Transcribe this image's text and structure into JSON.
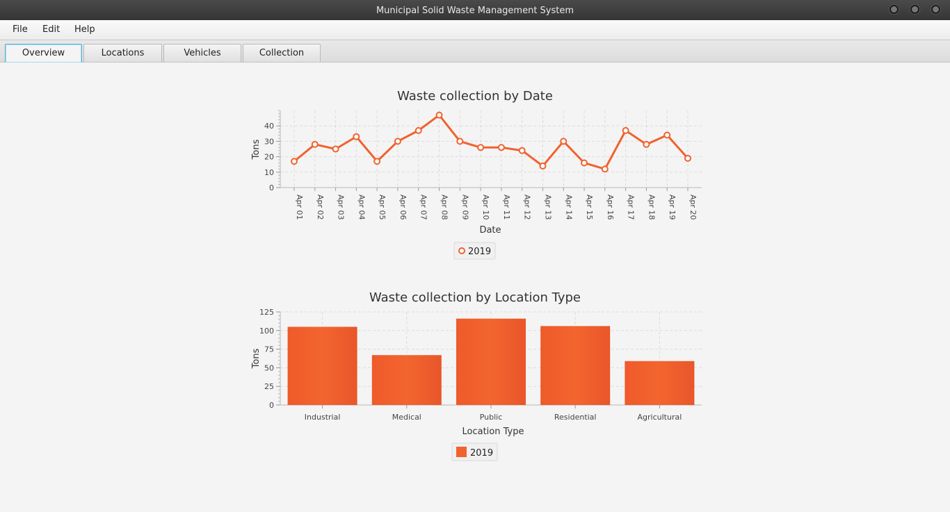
{
  "window": {
    "title": "Municipal Solid Waste Management System"
  },
  "menu": {
    "items": [
      "File",
      "Edit",
      "Help"
    ]
  },
  "tabs": [
    {
      "label": "Overview",
      "active": true
    },
    {
      "label": "Locations",
      "active": false
    },
    {
      "label": "Vehicles",
      "active": false
    },
    {
      "label": "Collection",
      "active": false
    }
  ],
  "colors": {
    "series": "#f0622e",
    "accent": "#5ab4dc"
  },
  "chart_data": [
    {
      "type": "line",
      "title": "Waste collection by Date",
      "xlabel": "Date",
      "ylabel": "Tons",
      "ylim": [
        0,
        50
      ],
      "yticks": [
        0,
        10,
        20,
        30,
        40
      ],
      "grid": true,
      "legend_position": "bottom",
      "categories": [
        "Apr 01",
        "Apr 02",
        "Apr 03",
        "Apr 04",
        "Apr 05",
        "Apr 06",
        "Apr 07",
        "Apr 08",
        "Apr 09",
        "Apr 10",
        "Apr 11",
        "Apr 12",
        "Apr 13",
        "Apr 14",
        "Apr 15",
        "Apr 16",
        "Apr 17",
        "Apr 18",
        "Apr 19",
        "Apr 20"
      ],
      "series": [
        {
          "name": "2019",
          "values": [
            17,
            28,
            25,
            33,
            17,
            30,
            37,
            47,
            30,
            26,
            26,
            24,
            14,
            30,
            16,
            12,
            37,
            28,
            34,
            19
          ]
        }
      ]
    },
    {
      "type": "bar",
      "title": "Waste collection by Location Type",
      "xlabel": "Location Type",
      "ylabel": "Tons",
      "ylim": [
        0,
        125
      ],
      "yticks": [
        0,
        25,
        50,
        75,
        100,
        125
      ],
      "grid": true,
      "legend_position": "bottom",
      "categories": [
        "Industrial",
        "Medical",
        "Public",
        "Residential",
        "Agricultural"
      ],
      "series": [
        {
          "name": "2019",
          "values": [
            105,
            67,
            116,
            106,
            59
          ]
        }
      ]
    }
  ]
}
